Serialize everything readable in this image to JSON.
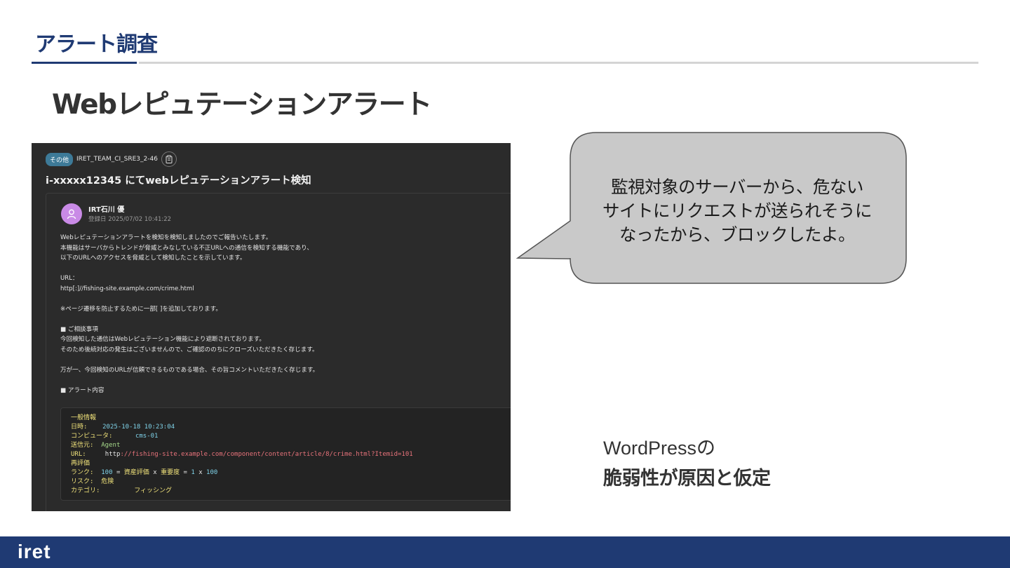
{
  "header": {
    "title": "アラート調査"
  },
  "slide": {
    "title": "Webレピュテーションアラート"
  },
  "screenshot": {
    "tag": "その他",
    "ticket_id": "IRET_TEAM_CI_SRE3_2-46",
    "copy_icon": "clipboard-icon",
    "title": "i-xxxxx12345 にてwebレピュテーションアラート検知",
    "sender": "IRT石川 優",
    "registered": "登録日 2025/07/02 10:41:22",
    "body": {
      "l1": "Webレピュテーションアラートを検知を検知しましたのでご報告いたします。",
      "l2": "本機能はサーバからトレンドが脅威とみなしている不正URLへの通信を検知する機能であり、",
      "l3": "以下のURLへのアクセスを脅威として検知したことを示しています。",
      "l4": "URL：",
      "l5": "http[:]//fishing-site.example.com/crime.html",
      "l6": "※ページ遷移を防止するために一部[ ]を追加しております。",
      "l7": "■ ご相談事項",
      "l8": "今回検知した通信はWebレピュテーション機能により遮断されております。",
      "l9": "そのため後続対応の発生はございませんので、ご確認ののちにクローズいただきたく存じます。",
      "l10": "万が一、今回検知のURLが信頼できるものである場合、その旨コメントいただきたく存じます。",
      "l11": "■ アラート内容"
    },
    "code": {
      "section1": "一般情報",
      "date_label": "日時:",
      "date_value": "2025-10-18 10:23:04",
      "computer_label": "コンピュータ:",
      "computer_value": "cms-01",
      "source_label": "送信元:",
      "source_value": "Agent",
      "url_label": "URL:",
      "url_scheme": "http",
      "url_rest": "://fishing-site.example.com/component/content/article/8/crime.html?Itemid=101",
      "section2": "再評価",
      "rank_label": "ランク:",
      "rank_value": "100",
      "rank_eq": "=",
      "rank_a": "資産評価",
      "rank_x": "x",
      "rank_b": "重要度",
      "rank_eq2": "=",
      "rank_1": "1",
      "rank_x2": "x",
      "rank_100": "100",
      "risk_label": "リスク:",
      "risk_value": "危険",
      "category_label": "カテゴリ:",
      "category_value": "フィッシング"
    }
  },
  "callout": {
    "line1": "監視対象のサーバーから、危ない",
    "line2": "サイトにリクエストが送られそうに",
    "line3": "なったから、ブロックしたよ。"
  },
  "cause": {
    "line1": "WordPressの",
    "line2": "脆弱性が原因と仮定"
  },
  "footer": {
    "logo": "iret"
  },
  "colors": {
    "brand": "#1f3a73",
    "bubble": "#c9c9c9",
    "dark_bg": "#2b2b2b",
    "tag": "#3d7a98",
    "avatar": "#c98ae6"
  }
}
